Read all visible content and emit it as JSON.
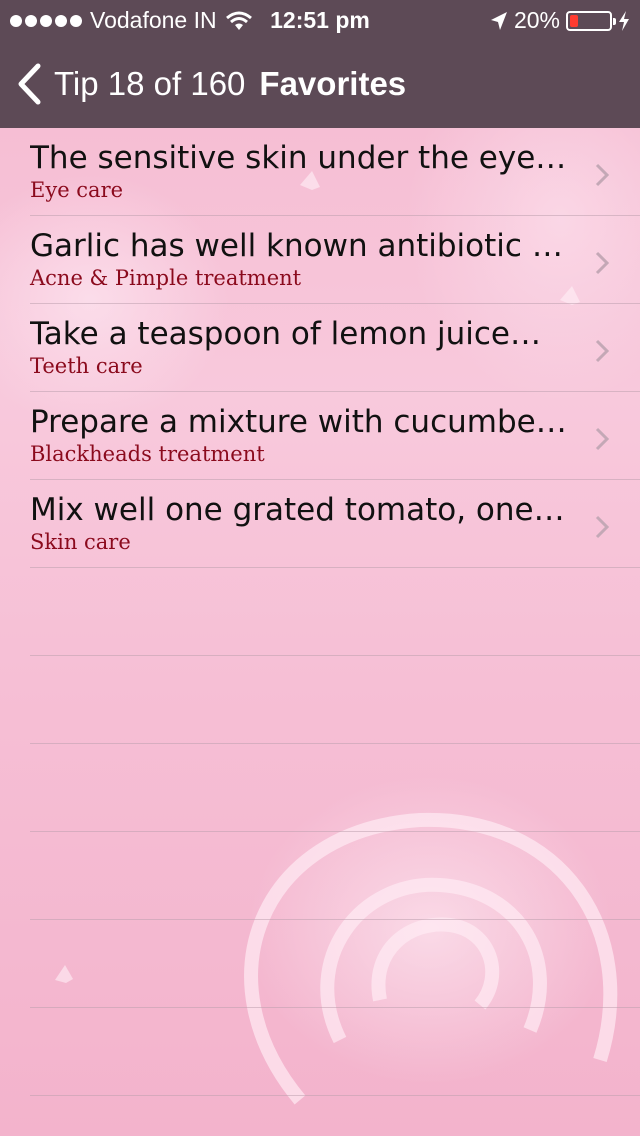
{
  "status_bar": {
    "carrier": "Vodafone IN",
    "time": "12:51 pm",
    "battery_percent": "20%",
    "battery_level": 0.2,
    "icons": [
      "signal-dots-icon",
      "wifi-icon",
      "location-arrow-icon",
      "battery-icon",
      "charging-bolt-icon"
    ]
  },
  "nav": {
    "back_label": "Tip 18 of 160",
    "title": "Favorites",
    "color": "#5d4a56"
  },
  "tips": [
    {
      "title": "The sensitive skin under the eyes is prone to wrinkles…",
      "category": "Eye care"
    },
    {
      "title": "Garlic has well known antibiotic properties…",
      "category": "Acne & Pimple treatment"
    },
    {
      "title": "Take a teaspoon of lemon juice…",
      "category": "Teeth care"
    },
    {
      "title": "Prepare a mixture with cucumber juice…",
      "category": "Blackheads treatment"
    },
    {
      "title": "Mix well one grated tomato, one…",
      "category": "Skin care"
    }
  ],
  "colors": {
    "category_text": "#8b0a1d",
    "background": "#f7c3d7"
  }
}
